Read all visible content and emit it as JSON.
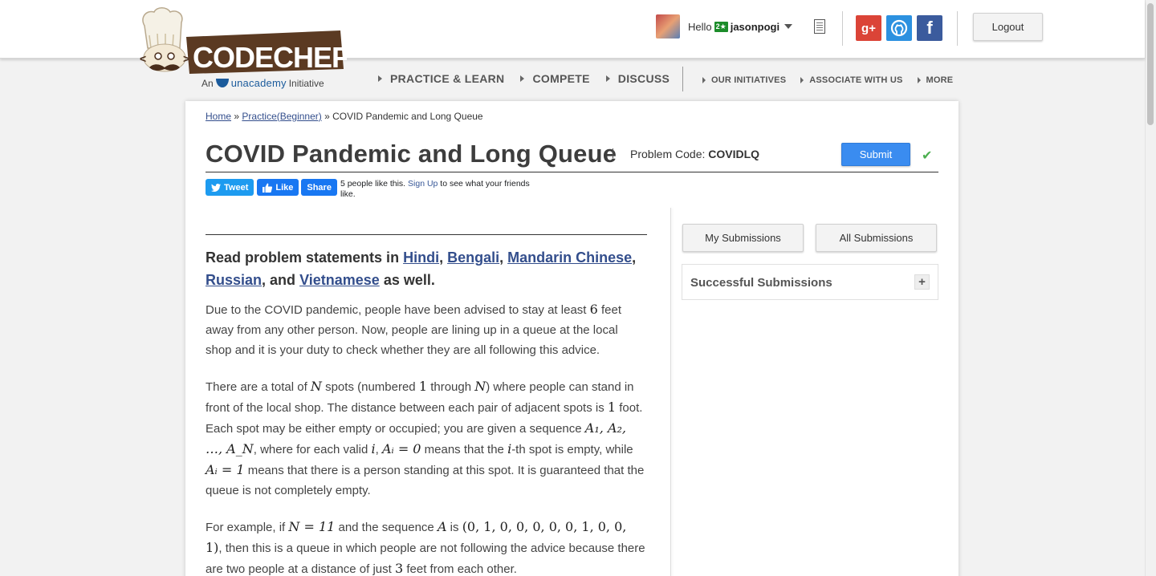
{
  "header": {
    "logo_text": "CODECHEF",
    "logo_sub_prefix": "An",
    "logo_sub_brand": "unacademy",
    "logo_sub_suffix": "Initiative",
    "greeting": "Hello",
    "star_badge": "2★",
    "username": "jasonpogi",
    "logout_label": "Logout",
    "social": {
      "gplus": "g+",
      "facebook": "f"
    }
  },
  "nav": {
    "main": [
      "PRACTICE & LEARN",
      "COMPETE",
      "DISCUSS"
    ],
    "secondary": [
      "OUR INITIATIVES",
      "ASSOCIATE WITH US",
      "MORE"
    ]
  },
  "breadcrumb": {
    "home": "Home",
    "sep": "»",
    "practice": "Practice(Beginner)",
    "current": "COVID Pandemic and Long Queue"
  },
  "problem": {
    "title": "COVID Pandemic and Long Queue",
    "code_label": "Problem Code:",
    "code": "COVIDLQ",
    "submit_label": "Submit",
    "check": "✔"
  },
  "share": {
    "tweet": "Tweet",
    "like": "Like",
    "share": "Share",
    "likes_text": "5 people like this.",
    "signup": "Sign Up",
    "friends_text": "to see what your friends like."
  },
  "statement": {
    "langs_prefix": "Read problem statements in",
    "langs": [
      "Hindi",
      "Bengali",
      "Mandarin Chinese",
      "Russian",
      "Vietnamese"
    ],
    "langs_and": "and",
    "langs_suffix": "as well.",
    "p1": {
      "a": "Due to the COVID pandemic, people have been advised to stay at least",
      "six": "6",
      "b": "feet away from any other person. Now, people are lining up in a queue at the local shop and it is your duty to check whether they are all following this advice."
    },
    "p2": {
      "a": "There are a total of",
      "N": "N",
      "b": "spots (numbered",
      "one": "1",
      "c": "through",
      "d": ") where people can stand in front of the local shop. The distance between each pair of adjacent spots is",
      "e": "foot. Each spot may be either empty or occupied; you are given a sequence",
      "seq": "A₁, A₂, …, A_N",
      "f": ", where for each valid",
      "i": "i",
      "ai0": "Aᵢ = 0",
      "g": "means that the",
      "h": "-th spot is empty, while",
      "ai1": "Aᵢ = 1",
      "j": "means that there is a person standing at this spot. It is guaranteed that the queue is not completely empty."
    },
    "p3": {
      "a": "For example, if",
      "n11": "N = 11",
      "b": "and the sequence",
      "A": "A",
      "c": "is",
      "tuple": "(0, 1, 0, 0, 0, 0, 0, 1, 0, 0, 1)",
      "d": ", then this is a queue in which people are not following the advice because there are two people at a distance of just",
      "three": "3",
      "e": "feet from each other."
    }
  },
  "sidebar": {
    "my_submissions": "My Submissions",
    "all_submissions": "All Submissions",
    "successful_title": "Successful Submissions",
    "expand": "+"
  },
  "colors": {
    "submit_blue": "#3a8cf0",
    "link": "#334e8c",
    "check_green": "#4caf50"
  }
}
